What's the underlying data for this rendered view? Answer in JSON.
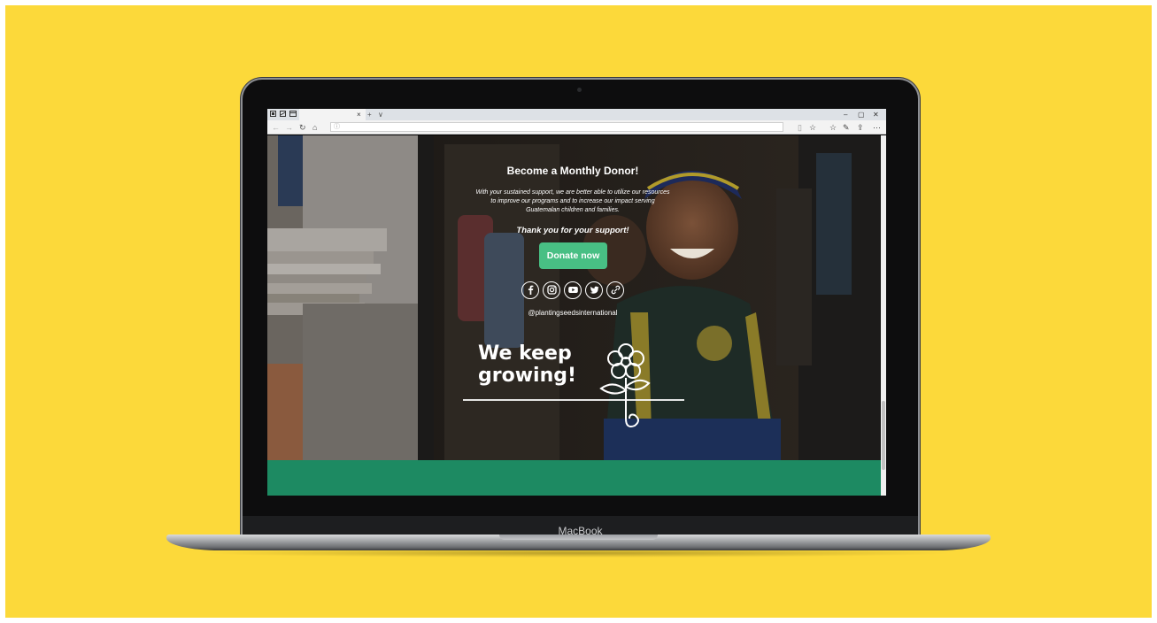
{
  "device": {
    "brand": "MacBook"
  },
  "browser": {
    "tab_close": "×",
    "tab_new": "+",
    "tab_more": "∨",
    "window_controls": [
      "–",
      "▢",
      "✕"
    ],
    "nav": {
      "back": "←",
      "forward": "→",
      "refresh": "↻",
      "home": "⌂"
    },
    "toolbar_icons": [
      "reading-view-icon",
      "favorite-star-icon",
      "favorites-icon",
      "pen-icon",
      "share-icon",
      "more-icon"
    ]
  },
  "page": {
    "title": "Become a Monthly Donor!",
    "blurb_lines": [
      "With your sustained support, we are better able to utilize our resources",
      "to improve our programs and to increase our impact serving",
      "Guatemalan children and families."
    ],
    "thanks": "Thank you for your support!",
    "donate_label": "Donate now",
    "socials": [
      "facebook-icon",
      "instagram-icon",
      "youtube-icon",
      "twitter-icon",
      "link-icon"
    ],
    "handle": "@plantingseedsinternational",
    "slogan_line1": "We keep",
    "slogan_line2": "growing!"
  },
  "colors": {
    "background": "#fcd93a",
    "donate_button": "#48bf84",
    "footer_band": "#1d8a62"
  }
}
